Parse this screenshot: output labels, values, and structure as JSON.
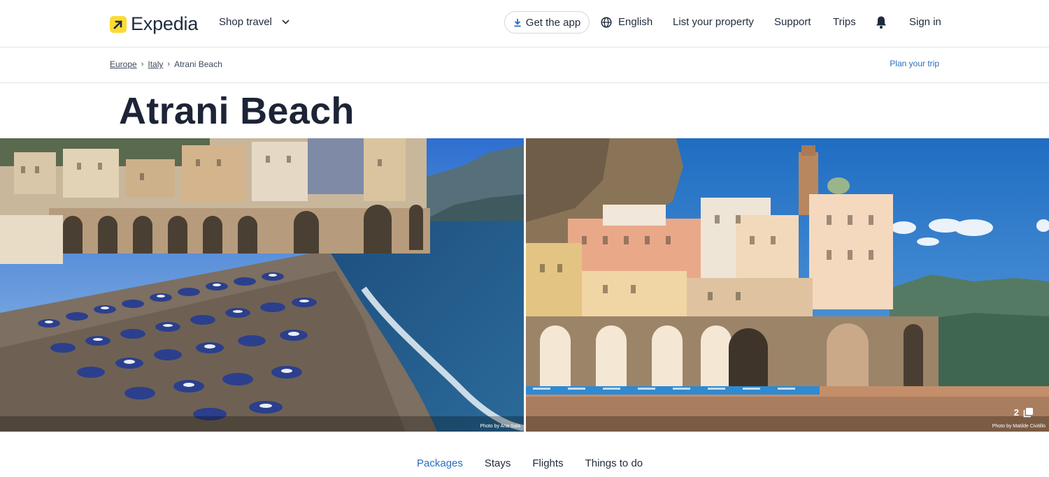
{
  "header": {
    "logo_text": "Expedia",
    "shop_travel": "Shop travel",
    "get_app": "Get the app",
    "language": "English",
    "list_property": "List your property",
    "support": "Support",
    "trips": "Trips",
    "sign_in": "Sign in"
  },
  "breadcrumb": {
    "items": [
      "Europe",
      "Italy",
      "Atrani Beach"
    ],
    "plan_trip": "Plan your trip"
  },
  "page_title": "Atrani Beach",
  "gallery": {
    "left_credit": "Photo by Ana Sala",
    "right_credit": "Photo by Matilde Civitillo",
    "photo_count": "2"
  },
  "tabs": [
    "Packages",
    "Stays",
    "Flights",
    "Things to do"
  ],
  "colors": {
    "accent": "#2a6ebd",
    "logo_yellow": "#fddb32",
    "text": "#1f2b3d"
  }
}
